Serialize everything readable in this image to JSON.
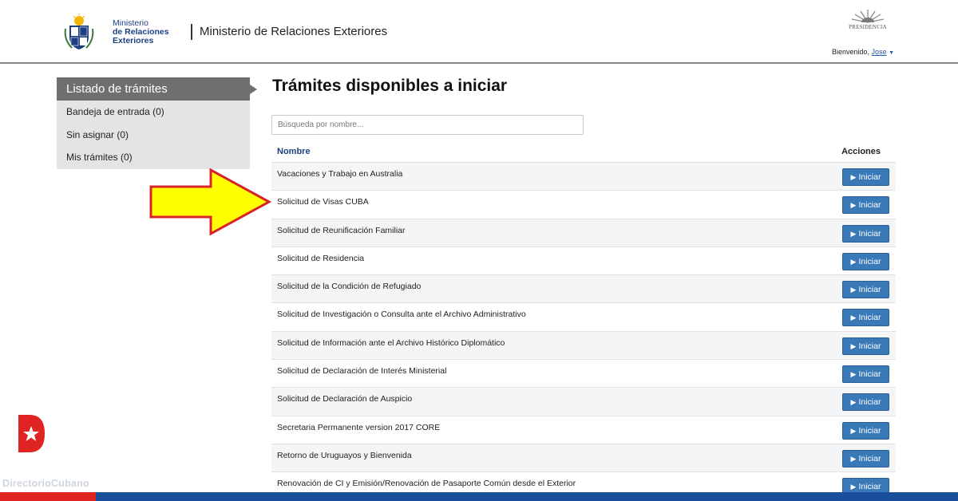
{
  "header": {
    "org_line1": "Ministerio",
    "org_line2": "de Relaciones",
    "org_line3": "Exteriores",
    "site_title": "Ministerio de Relaciones Exteriores",
    "presidencia_label": "PRESIDENCIA",
    "welcome_text": "Bienvenido,",
    "user_name": "Jose"
  },
  "sidebar": {
    "title": "Listado de trámites",
    "items": [
      {
        "label": "Bandeja de entrada (0)"
      },
      {
        "label": "Sin asignar (0)"
      },
      {
        "label": "Mis trámites (0)"
      }
    ]
  },
  "main": {
    "title": "Trámites disponibles a iniciar",
    "search_placeholder": "Búsqueda por nombre...",
    "table": {
      "col_name": "Nombre",
      "col_actions": "Acciones",
      "button_label": "Iniciar",
      "rows": [
        {
          "name": "Vacaciones y Trabajo en Australia"
        },
        {
          "name": "Solicitud de Visas CUBA"
        },
        {
          "name": "Solicitud de Reunificación Familiar"
        },
        {
          "name": "Solicitud de Residencia"
        },
        {
          "name": "Solicitud de la Condición de Refugiado"
        },
        {
          "name": "Solicitud de Investigación o Consulta ante el Archivo Administrativo"
        },
        {
          "name": "Solicitud de Información ante el Archivo Histórico Diplomático"
        },
        {
          "name": "Solicitud de Declaración de Interés Ministerial"
        },
        {
          "name": "Solicitud de Declaración de Auspicio"
        },
        {
          "name": "Secretaria Permanente version 2017 CORE"
        },
        {
          "name": "Retorno de Uruguayos y Bienvenida"
        },
        {
          "name": "Renovación de CI y Emisión/Renovación de Pasaporte Común desde el Exterior"
        }
      ]
    }
  },
  "watermark": {
    "text": "DirectorioCubano"
  },
  "colors": {
    "button_blue": "#3979b8",
    "sidebar_head": "#6f6f6f",
    "arrow_fill": "#ffff00",
    "arrow_stroke": "#d8232a",
    "bottom_red": "#e02421",
    "bottom_blue": "#1a4f9b"
  }
}
